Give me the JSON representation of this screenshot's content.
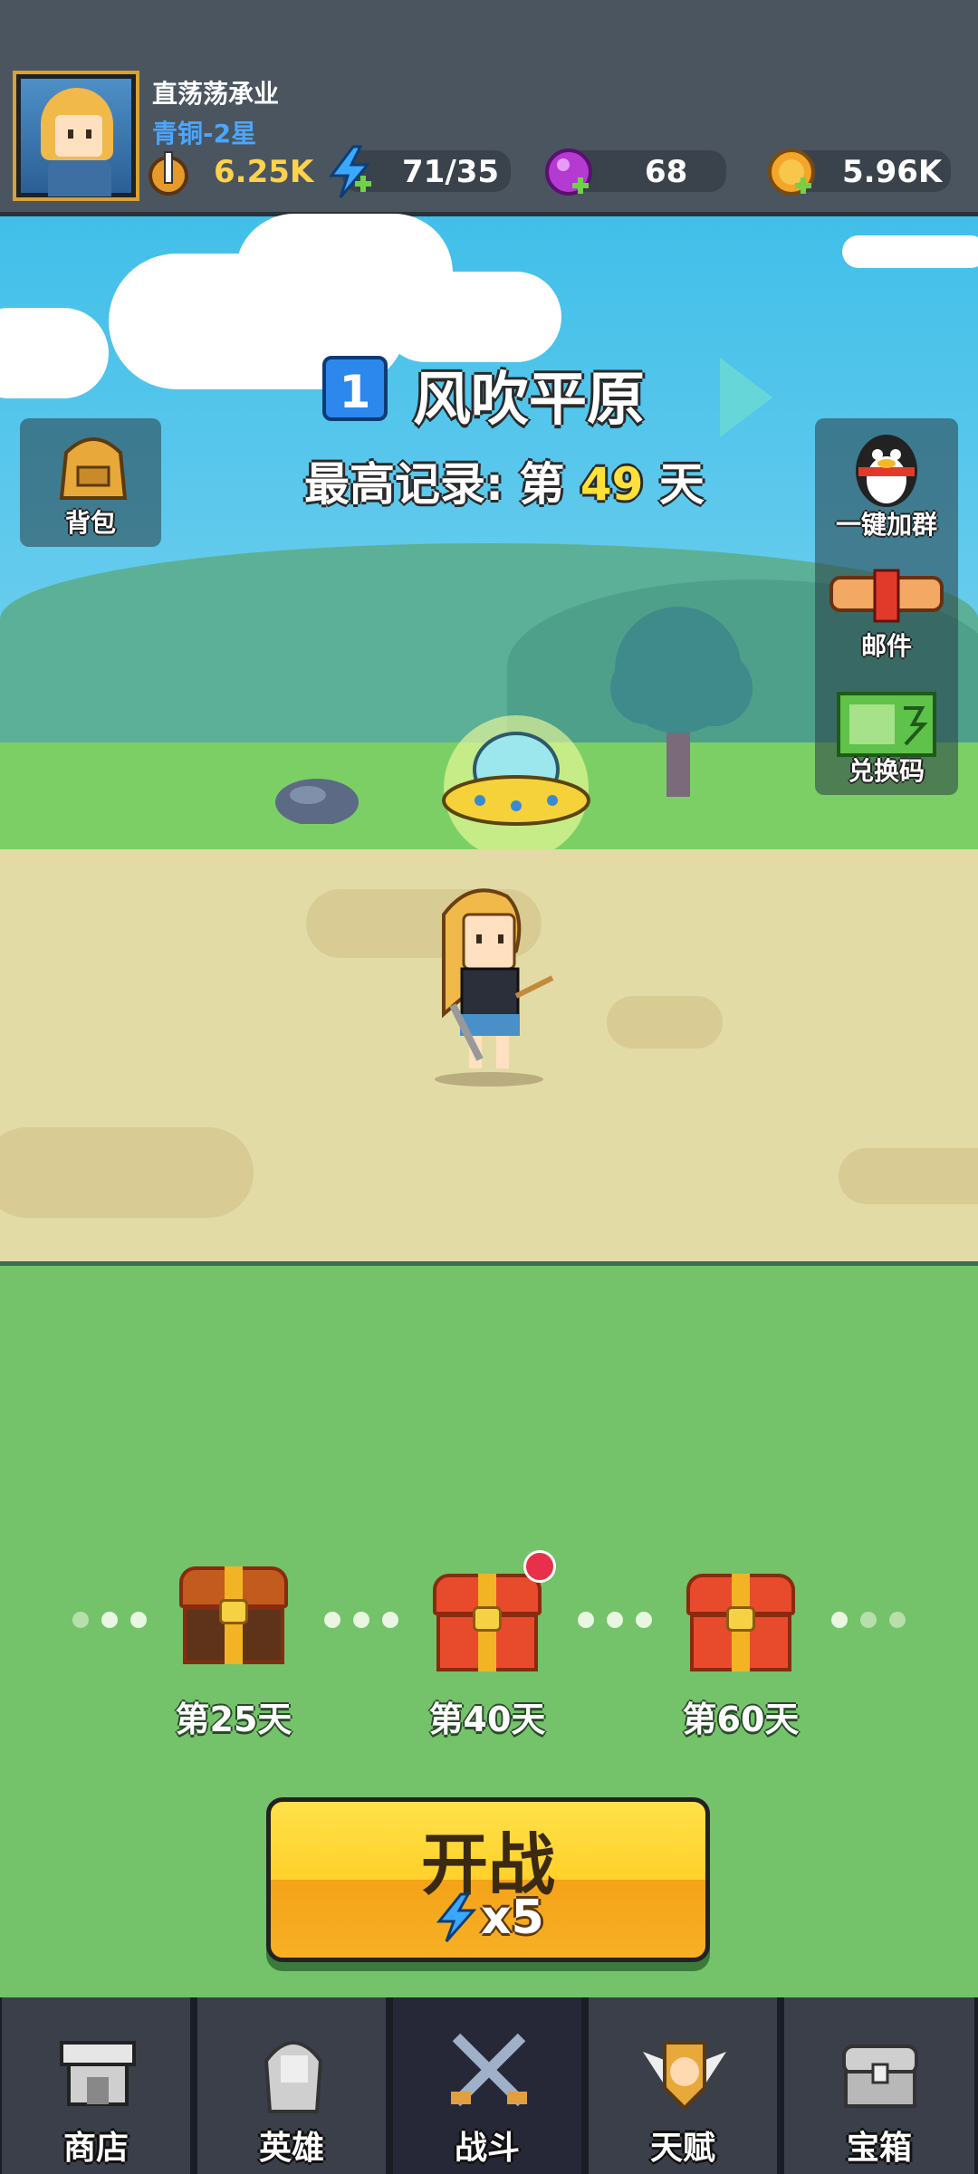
{
  "player": {
    "name": "直荡荡承业",
    "rank": "青铜-2星",
    "power": "6.25K",
    "energy": "71/35",
    "gems": "68",
    "coins": "5.96K"
  },
  "level": {
    "number": "1",
    "name": "风吹平原",
    "record_prefix": "最高记录: 第",
    "record_day": "49",
    "record_suffix": "天"
  },
  "side_left": {
    "backpack": "背包"
  },
  "side_right": {
    "qq_group": "一键加群",
    "mail": "邮件",
    "redeem": "兑换码"
  },
  "chests": [
    {
      "label": "第25天",
      "state": "opened"
    },
    {
      "label": "第40天",
      "state": "ready",
      "badge": true
    },
    {
      "label": "第60天",
      "state": "locked"
    }
  ],
  "start_button": {
    "label": "开战",
    "cost": "x5"
  },
  "nav": {
    "shop": "商店",
    "heroes": "英雄",
    "battle": "战斗",
    "talent": "天赋",
    "chest": "宝箱",
    "active": "battle"
  },
  "colors": {
    "accent_yellow": "#ffd12a",
    "sky": "#41bfe9",
    "grass": "#74c26a",
    "rank_blue": "#4aa6ff"
  }
}
